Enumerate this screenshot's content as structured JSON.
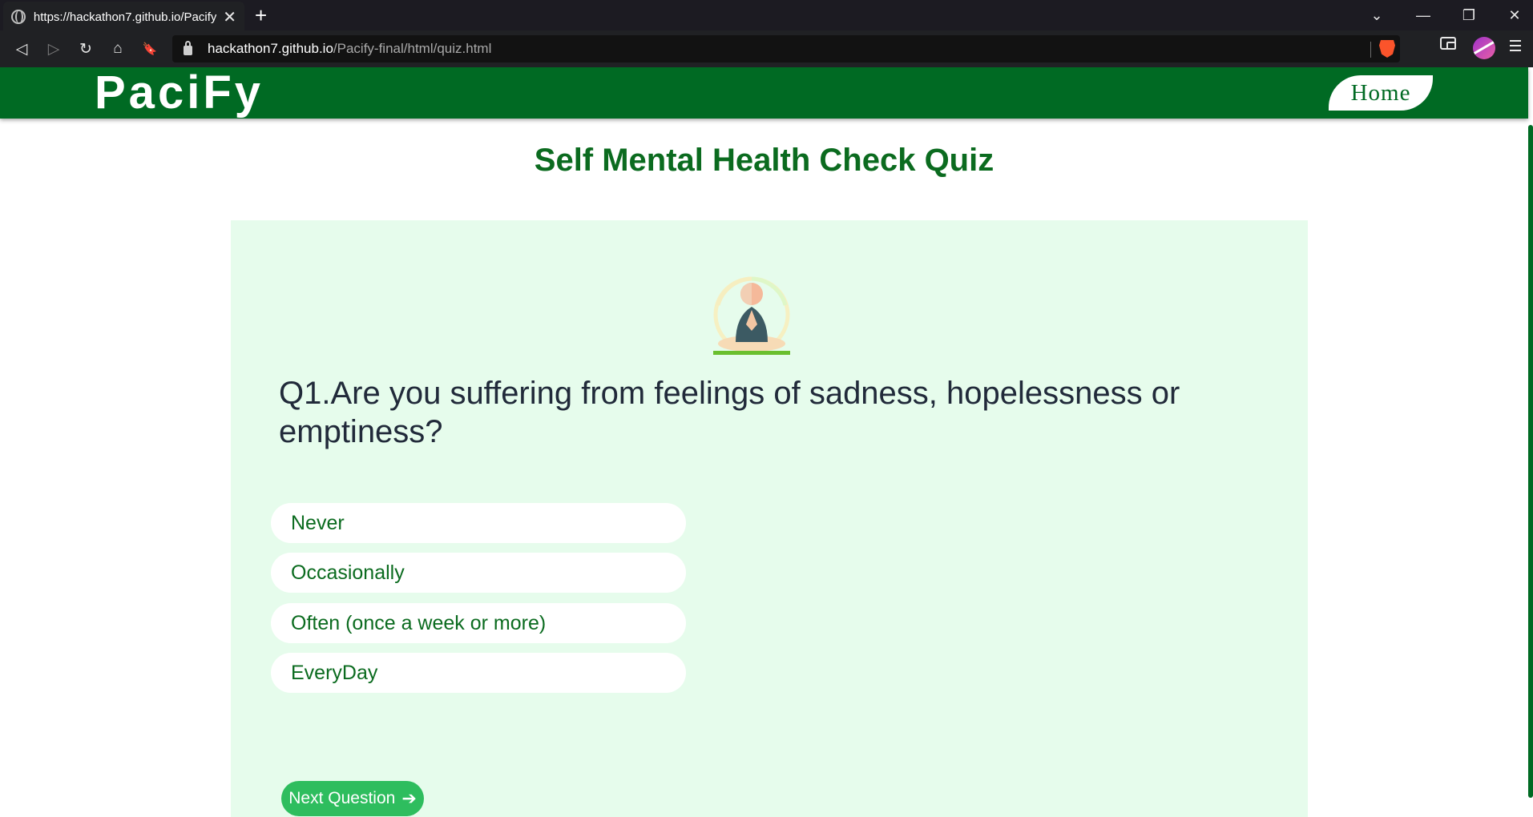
{
  "browser": {
    "tab_title": "https://hackathon7.github.io/Pacify",
    "tab_close": "✕",
    "new_tab": "+",
    "url_host": "hackathon7.github.io",
    "url_path": "/Pacify-final/html/quiz.html",
    "controls": {
      "tabs_dropdown": "⌄",
      "minimize": "—",
      "restore": "❐",
      "close": "✕"
    },
    "nav": {
      "back": "◁",
      "forward": "▷",
      "reload": "↻",
      "home": "⌂",
      "bookmark": "🔖"
    }
  },
  "header": {
    "brand": "PaciFy",
    "home_label": "Home",
    "color": "#006a23"
  },
  "quiz": {
    "title": "Self Mental Health Check Quiz",
    "question": "Q1.Are you suffering from feelings of sadness, hopelessness or emptiness?",
    "options": [
      "Never",
      "Occasionally",
      "Often (once a week or more)",
      "EveryDay"
    ],
    "next_label": "Next Question",
    "next_arrow": "➔",
    "illustration": "meditation-icon"
  },
  "colors": {
    "card_bg": "#e6fcec",
    "accent": "#2ebd5e",
    "text_green": "#0b6b1f"
  }
}
